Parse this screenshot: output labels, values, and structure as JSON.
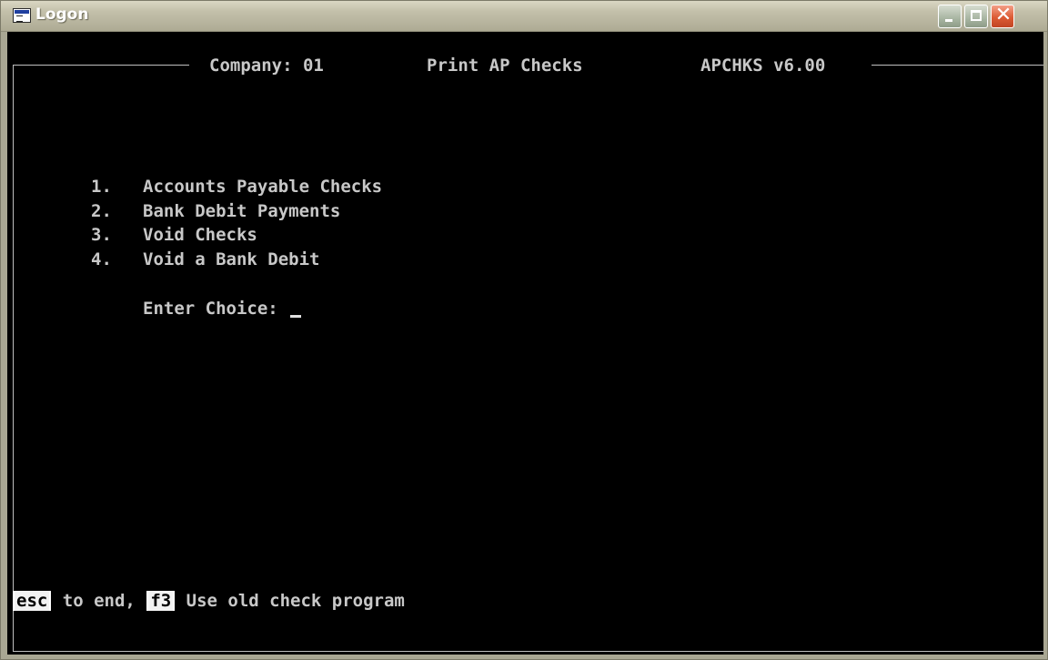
{
  "window": {
    "title": "Logon"
  },
  "header": {
    "company": "Company: 01",
    "program_title": "Print AP Checks",
    "version": "APCHKS v6.00"
  },
  "menu": {
    "items": [
      {
        "num": "1.",
        "label": "Accounts Payable Checks"
      },
      {
        "num": "2.",
        "label": "Bank Debit Payments"
      },
      {
        "num": "3.",
        "label": "Void Checks"
      },
      {
        "num": "4.",
        "label": "Void a Bank Debit"
      }
    ],
    "prompt": "Enter Choice:"
  },
  "footer": {
    "esc_key": "esc",
    "esc_text": "to end,",
    "f3_key": "f3",
    "f3_text": "Use old check program"
  }
}
